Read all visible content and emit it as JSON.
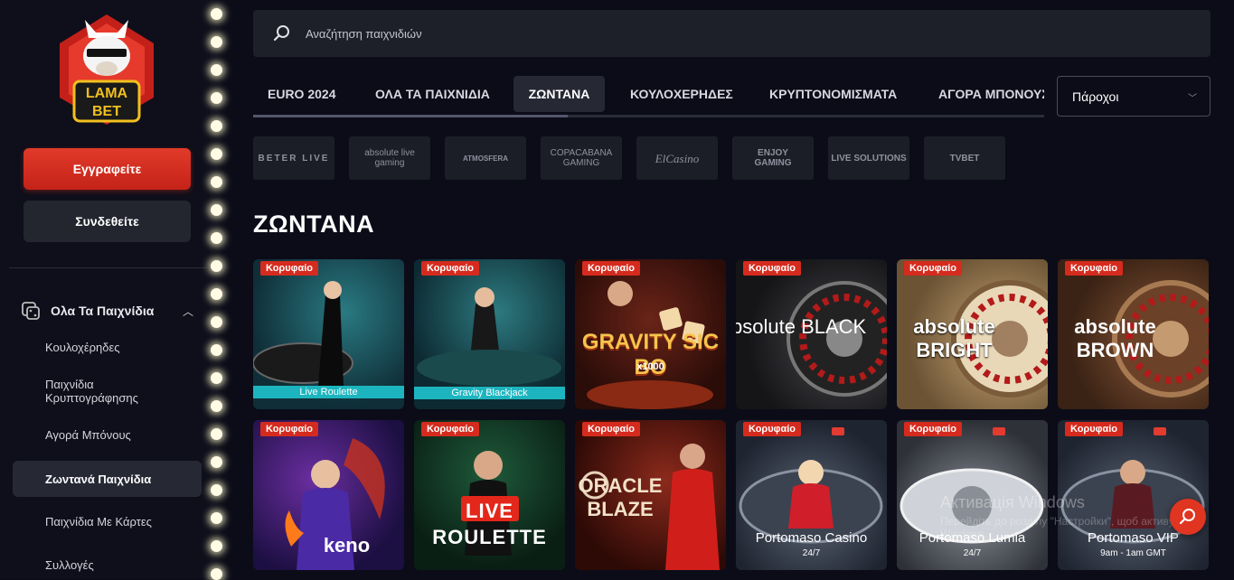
{
  "brand": {
    "logo_line1": "LAMA",
    "logo_line2": "BET"
  },
  "sidebar": {
    "register_label": "Εγγραφείτε",
    "login_label": "Συνδεθείτε",
    "section_label": "Ολα Τα Παιχνίδια",
    "items": [
      {
        "label": "Κουλοχέρηδες"
      },
      {
        "label": "Παιχνίδια Κρυπτογράφησης"
      },
      {
        "label": "Αγορά Μπόνους"
      },
      {
        "label": "Ζωντανά Παιχνίδια"
      },
      {
        "label": "Παιχνίδια Με Κάρτες"
      },
      {
        "label": "Συλλογές"
      }
    ]
  },
  "search": {
    "placeholder": "Αναζήτηση παιχνιδιών"
  },
  "tabs": [
    {
      "label": "EURO 2024"
    },
    {
      "label": "ΟΛΑ ΤΑ ΠΑΙΧΝΙΔΙΑ"
    },
    {
      "label": "ΖΩΝΤΑΝΑ"
    },
    {
      "label": "ΚΟΥΛΟΧΕΡΗΔΕΣ"
    },
    {
      "label": "ΚΡΥΠΤΟΝΟΜΙΣΜΑΤΑ"
    },
    {
      "label": "ΑΓΟΡΑ ΜΠΟΝΟΥΣ"
    }
  ],
  "providers_dropdown": {
    "label": "Πάροχοι"
  },
  "providers": [
    {
      "name": "BETER LIVE"
    },
    {
      "name": "absolute live gaming"
    },
    {
      "name": "ATMOSFERA"
    },
    {
      "name": "COPACABANA GAMING"
    },
    {
      "name": "ElCasino"
    },
    {
      "name": "ENJOY GAMING"
    },
    {
      "name": "LIVE SOLUTIONS"
    },
    {
      "name": "TVBET"
    }
  ],
  "section_title": "ΖΩΝΤΑΝΑ",
  "badge_label": "Κορυφαίο",
  "games": [
    {
      "title": "Live Roulette"
    },
    {
      "title": "Gravity Blackjack"
    },
    {
      "title": "GRAVITY SIC BO",
      "sub": "x1000"
    },
    {
      "title": "absolute BLACK"
    },
    {
      "title": "absolute BRIGHT"
    },
    {
      "title": "absolute BROWN"
    },
    {
      "title": "keno"
    },
    {
      "title": "LIVE ROULETTE"
    },
    {
      "title": "ORACLE BLAZE"
    },
    {
      "title": "Portomaso Casino",
      "sub": "24/7"
    },
    {
      "title": "Portomaso Lumia",
      "sub": "24/7"
    },
    {
      "title": "Portomaso VIP",
      "sub": "9am - 1am GMT"
    }
  ],
  "overlay": {
    "windows_line1": "Активація Windows",
    "windows_line2": "Перейдіть до розділу \"Настройки\", щоб активувати Windows."
  }
}
